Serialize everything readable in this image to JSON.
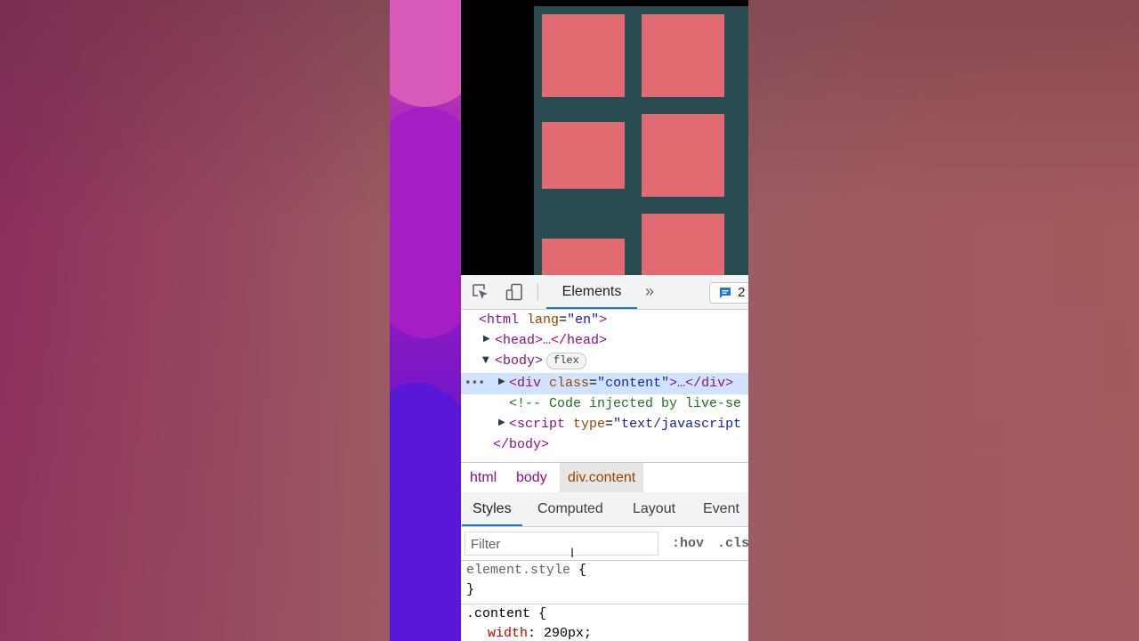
{
  "devtools": {
    "toolbar": {
      "elements_tab": "Elements",
      "more_tabs": "»",
      "issues_count": "2"
    },
    "dom": {
      "html_open": "<html",
      "html_lang_attr": "lang",
      "html_lang_val": "\"en\"",
      "html_close_bracket": ">",
      "head": "<head>…</head>",
      "body_open": "<body>",
      "flex_badge": "flex",
      "div_open": "<div",
      "div_class_attr": "class",
      "div_class_val": "\"content\"",
      "div_rest": ">…</div>",
      "comment": "<!-- Code injected by live-se",
      "script_open": "<script",
      "script_type_attr": "type",
      "script_type_val": "\"text/javascript",
      "body_close": "</body>"
    },
    "breadcrumbs": [
      "html",
      "body",
      "div.content"
    ],
    "styles_tabs": [
      "Styles",
      "Computed",
      "Layout",
      "Event L"
    ],
    "filter_placeholder": "Filter",
    "hov": ":hov",
    "cls": ".cls",
    "rules": {
      "element_style": "element.style",
      "open_brace": " {",
      "close_brace": "}",
      "content_selector": ".content",
      "width_prop": "width",
      "width_val": "290px;"
    }
  },
  "colors": {
    "tile": "#e26b72",
    "content_bg": "#294c53",
    "accent": "#1a73e8"
  }
}
